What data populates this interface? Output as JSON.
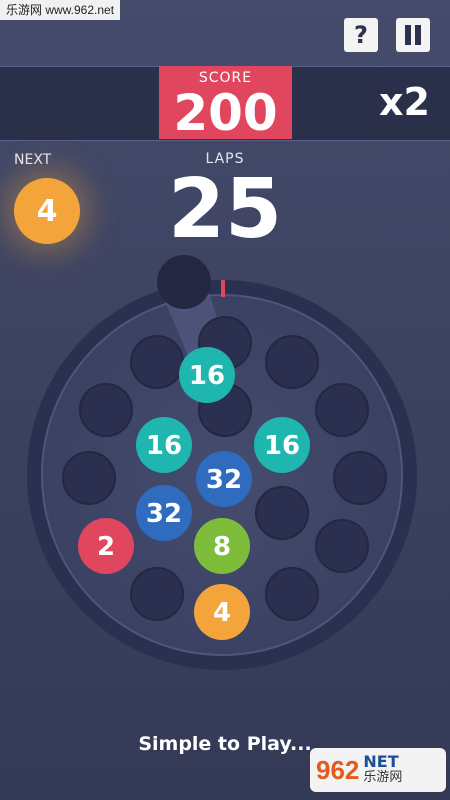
{
  "watermark": {
    "site": "乐游网 www.962.net",
    "logo_num": "962",
    "logo_net": "NET",
    "logo_cn": "乐游网"
  },
  "header": {
    "help_label": "?",
    "pause_icon": "pause-icon"
  },
  "score": {
    "label": "SCORE",
    "value": "200",
    "multiplier": "x2"
  },
  "next": {
    "label": "NEXT",
    "value": "4",
    "color": "#f3a53b"
  },
  "laps": {
    "label": "LAPS",
    "value": "25"
  },
  "board": {
    "balls": [
      {
        "value": "16",
        "color": "#1fb6b0"
      },
      {
        "value": "16",
        "color": "#1fb6b0"
      },
      {
        "value": "16",
        "color": "#1fb6b0"
      },
      {
        "value": "32",
        "color": "#2f6cbf"
      },
      {
        "value": "32",
        "color": "#2f6cbf"
      },
      {
        "value": "2",
        "color": "#e0475e"
      },
      {
        "value": "8",
        "color": "#7ebd3c"
      },
      {
        "value": "4",
        "color": "#f3a53b"
      }
    ]
  },
  "tagline": "Simple to Play..."
}
